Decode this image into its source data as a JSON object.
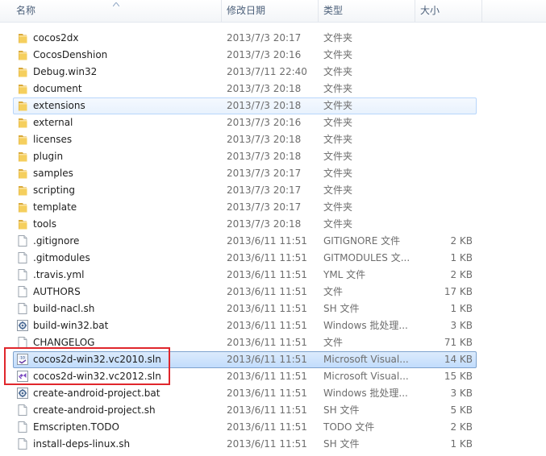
{
  "columns": {
    "name": "名称",
    "date": "修改日期",
    "type": "类型",
    "size": "大小"
  },
  "rows": [
    {
      "name": "cocos2dx",
      "date": "2013/7/3 20:17",
      "type": "文件夹",
      "size": "",
      "icon": "folder-icon"
    },
    {
      "name": "CocosDenshion",
      "date": "2013/7/3 20:16",
      "type": "文件夹",
      "size": "",
      "icon": "folder-icon"
    },
    {
      "name": "Debug.win32",
      "date": "2013/7/11 22:40",
      "type": "文件夹",
      "size": "",
      "icon": "folder-icon"
    },
    {
      "name": "document",
      "date": "2013/7/3 20:18",
      "type": "文件夹",
      "size": "",
      "icon": "folder-icon"
    },
    {
      "name": "extensions",
      "date": "2013/7/3 20:18",
      "type": "文件夹",
      "size": "",
      "icon": "folder-icon",
      "state": "hover"
    },
    {
      "name": "external",
      "date": "2013/7/3 20:16",
      "type": "文件夹",
      "size": "",
      "icon": "folder-icon"
    },
    {
      "name": "licenses",
      "date": "2013/7/3 20:18",
      "type": "文件夹",
      "size": "",
      "icon": "folder-icon"
    },
    {
      "name": "plugin",
      "date": "2013/7/3 20:18",
      "type": "文件夹",
      "size": "",
      "icon": "folder-icon"
    },
    {
      "name": "samples",
      "date": "2013/7/3 20:17",
      "type": "文件夹",
      "size": "",
      "icon": "folder-icon"
    },
    {
      "name": "scripting",
      "date": "2013/7/3 20:17",
      "type": "文件夹",
      "size": "",
      "icon": "folder-icon"
    },
    {
      "name": "template",
      "date": "2013/7/3 20:17",
      "type": "文件夹",
      "size": "",
      "icon": "folder-icon"
    },
    {
      "name": "tools",
      "date": "2013/7/3 20:18",
      "type": "文件夹",
      "size": "",
      "icon": "folder-icon"
    },
    {
      "name": ".gitignore",
      "date": "2013/6/11 11:51",
      "type": "GITIGNORE 文件",
      "size": "2 KB",
      "icon": "file-icon"
    },
    {
      "name": ".gitmodules",
      "date": "2013/6/11 11:51",
      "type": "GITMODULES 文...",
      "size": "1 KB",
      "icon": "file-icon"
    },
    {
      "name": ".travis.yml",
      "date": "2013/6/11 11:51",
      "type": "YML 文件",
      "size": "2 KB",
      "icon": "file-icon"
    },
    {
      "name": "AUTHORS",
      "date": "2013/6/11 11:51",
      "type": "文件",
      "size": "17 KB",
      "icon": "file-icon"
    },
    {
      "name": "build-nacl.sh",
      "date": "2013/6/11 11:51",
      "type": "SH 文件",
      "size": "1 KB",
      "icon": "file-icon"
    },
    {
      "name": "build-win32.bat",
      "date": "2013/6/11 11:51",
      "type": "Windows 批处理...",
      "size": "3 KB",
      "icon": "batch-icon"
    },
    {
      "name": "CHANGELOG",
      "date": "2013/6/11 11:51",
      "type": "文件",
      "size": "71 KB",
      "icon": "file-icon"
    },
    {
      "name": "cocos2d-win32.vc2010.sln",
      "date": "2013/6/11 11:51",
      "type": "Microsoft Visual...",
      "size": "14 KB",
      "icon": "vs2010-sln-icon",
      "state": "selected"
    },
    {
      "name": "cocos2d-win32.vc2012.sln",
      "date": "2013/6/11 11:51",
      "type": "Microsoft Visual...",
      "size": "15 KB",
      "icon": "vs2012-sln-icon"
    },
    {
      "name": "create-android-project.bat",
      "date": "2013/6/11 11:51",
      "type": "Windows 批处理...",
      "size": "3 KB",
      "icon": "batch-icon"
    },
    {
      "name": "create-android-project.sh",
      "date": "2013/6/11 11:51",
      "type": "SH 文件",
      "size": "5 KB",
      "icon": "file-icon"
    },
    {
      "name": "Emscripten.TODO",
      "date": "2013/6/11 11:51",
      "type": "TODO 文件",
      "size": "2 KB",
      "icon": "file-icon"
    },
    {
      "name": "install-deps-linux.sh",
      "date": "2013/6/11 11:51",
      "type": "SH 文件",
      "size": "1 KB",
      "icon": "file-icon"
    }
  ],
  "colors": {
    "highlight_box": "#e0262c",
    "selection_border": "#7da2ce",
    "folder": "#f2c94c"
  }
}
